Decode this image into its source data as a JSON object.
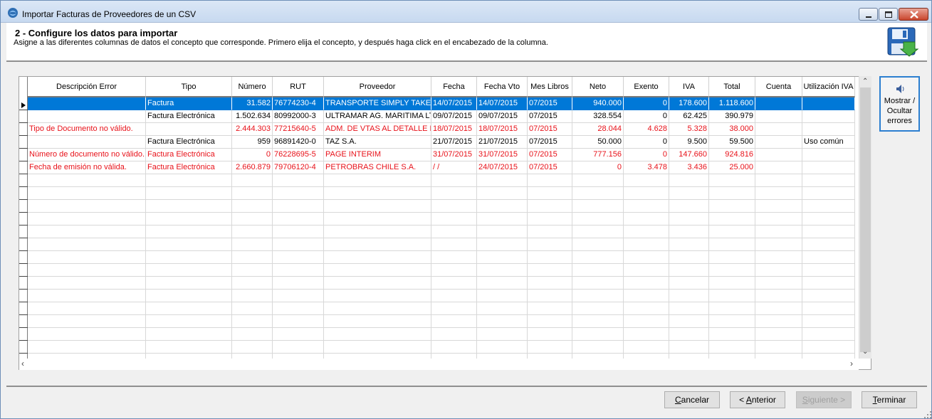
{
  "window": {
    "title": "Importar Facturas de Proveedores de un CSV"
  },
  "header": {
    "title": "2 - Configure los datos para importar",
    "subtitle": "Asigne a las diferentes columnas de datos el concepto que corresponde. Primero elija el concepto, y después haga click en el encabezado de la columna."
  },
  "grid": {
    "columns": [
      "Descripción Error",
      "Tipo",
      "Número",
      "RUT",
      "Proveedor",
      "Fecha",
      "Fecha Vto",
      "Mes Libros",
      "Neto",
      "Exento",
      "IVA",
      "Total",
      "Cuenta",
      "Utilización IVA"
    ],
    "rows": [
      {
        "state": "selected",
        "cells": [
          "",
          "Factura",
          "31.582",
          "76774230-4",
          "TRANSPORTE SIMPLY TAKE C",
          "14/07/2015",
          "14/07/2015",
          "07/2015",
          "940.000",
          "0",
          "178.600",
          "1.118.600",
          "",
          ""
        ]
      },
      {
        "state": "normal",
        "cells": [
          "",
          "Factura Electrónica",
          "1.502.634",
          "80992000-3",
          "ULTRAMAR AG. MARITIMA LTI",
          "09/07/2015",
          "09/07/2015",
          "07/2015",
          "328.554",
          "0",
          "62.425",
          "390.979",
          "",
          ""
        ]
      },
      {
        "state": "error",
        "cells": [
          "Tipo de Documento no válido.",
          "",
          "2.444.303",
          "77215640-5",
          "ADM. DE VTAS AL DETALLE L",
          "18/07/2015",
          "18/07/2015",
          "07/2015",
          "28.044",
          "4.628",
          "5.328",
          "38.000",
          "",
          ""
        ]
      },
      {
        "state": "normal",
        "cells": [
          "",
          "Factura Electrónica",
          "959",
          "96891420-0",
          "TAZ S.A.",
          "21/07/2015",
          "21/07/2015",
          "07/2015",
          "50.000",
          "0",
          "9.500",
          "59.500",
          "",
          "Uso común"
        ]
      },
      {
        "state": "error",
        "cells": [
          "Número de documento no válido.",
          "Factura Electrónica",
          "0",
          "76228695-5",
          "PAGE INTERIM",
          "31/07/2015",
          "31/07/2015",
          "07/2015",
          "777.156",
          "0",
          "147.660",
          "924.816",
          "",
          ""
        ]
      },
      {
        "state": "error",
        "cells": [
          "Fecha de emisión no válida.",
          "Factura Electrónica",
          "2.660.879",
          "79706120-4",
          "PETROBRAS CHILE S.A.",
          "/  /",
          "24/07/2015",
          "07/2015",
          "0",
          "3.478",
          "3.436",
          "25.000",
          "",
          ""
        ]
      }
    ]
  },
  "toggle_errors": {
    "label_line1": "Mostrar /",
    "label_line2": "Ocultar",
    "label_line3": "errores"
  },
  "buttons": {
    "cancel_pre": "",
    "cancel_key": "C",
    "cancel_post": "ancelar",
    "prev_pre": "< ",
    "prev_key": "A",
    "prev_post": "nterior",
    "next_pre": "",
    "next_key": "S",
    "next_post": "iguiente >",
    "finish_pre": "",
    "finish_key": "T",
    "finish_post": "erminar"
  },
  "colors": {
    "selection": "#0078d7",
    "error_text": "#e8121a"
  }
}
